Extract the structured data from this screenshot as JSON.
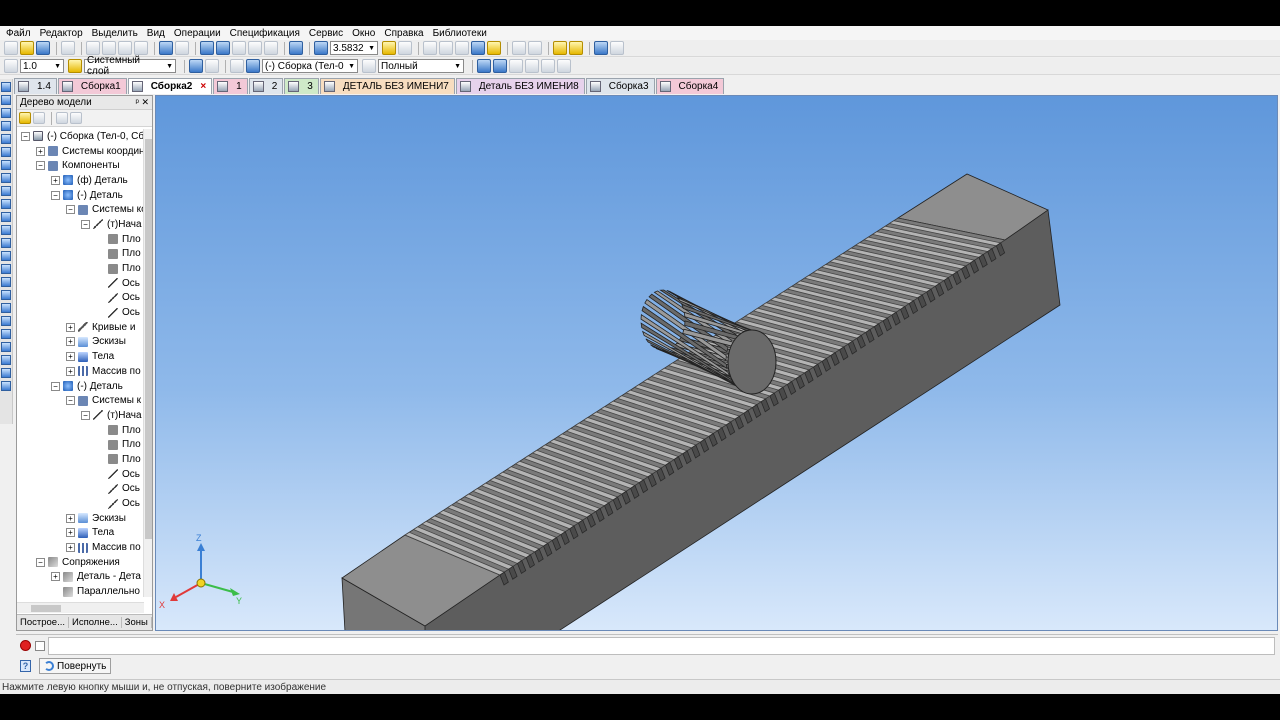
{
  "menu": [
    "Файл",
    "Редактор",
    "Выделить",
    "Вид",
    "Операции",
    "Спецификация",
    "Сервис",
    "Окно",
    "Справка",
    "Библиотеки"
  ],
  "toolbar": {
    "zoom_value": "3.5832",
    "line_weight": "1.0",
    "layer": "Системный слой",
    "object_filter": "(-) Сборка (Тел-0",
    "display_mode": "Полный"
  },
  "tabs": [
    {
      "label": "1.4",
      "style": "plain"
    },
    {
      "label": "Сборка1",
      "style": "pink"
    },
    {
      "label": "Сборка2",
      "style": "active"
    },
    {
      "label": "1",
      "style": "pink"
    },
    {
      "label": "2",
      "style": "plain"
    },
    {
      "label": "3",
      "style": "green"
    },
    {
      "label": "ДЕТАЛЬ БЕЗ ИМЕНИ7",
      "style": "orange"
    },
    {
      "label": "Деталь БЕЗ ИМЕНИ8",
      "style": "violet"
    },
    {
      "label": "Сборка3",
      "style": "plain"
    },
    {
      "label": "Сборка4",
      "style": "pink"
    }
  ],
  "tree": {
    "title": "Дерево модели",
    "nodes": [
      {
        "label": "(-) Сборка (Тел-0, Сб",
        "exp": "−",
        "indent": 0,
        "icon": "asm"
      },
      {
        "label": "Системы координ",
        "exp": "+",
        "indent": 1,
        "icon": "sys"
      },
      {
        "label": "Компоненты",
        "exp": "−",
        "indent": 1,
        "icon": "sys"
      },
      {
        "label": "(ф) Деталь",
        "exp": "+",
        "indent": 2,
        "icon": "part"
      },
      {
        "label": "(-) Деталь",
        "exp": "−",
        "indent": 2,
        "icon": "part"
      },
      {
        "label": "Системы ко",
        "exp": "−",
        "indent": 3,
        "icon": "sys"
      },
      {
        "label": "(т)Нача",
        "exp": "−",
        "indent": 4,
        "icon": "axis"
      },
      {
        "label": "Пло",
        "exp": "",
        "indent": 5,
        "icon": "plane"
      },
      {
        "label": "Пло",
        "exp": "",
        "indent": 5,
        "icon": "plane"
      },
      {
        "label": "Пло",
        "exp": "",
        "indent": 5,
        "icon": "plane"
      },
      {
        "label": "Ось",
        "exp": "",
        "indent": 5,
        "icon": "axis"
      },
      {
        "label": "Ось",
        "exp": "",
        "indent": 5,
        "icon": "axis"
      },
      {
        "label": "Ось",
        "exp": "",
        "indent": 5,
        "icon": "axis"
      },
      {
        "label": "Кривые и",
        "exp": "+",
        "indent": 3,
        "icon": "curve"
      },
      {
        "label": "Эскизы",
        "exp": "+",
        "indent": 3,
        "icon": "sketch"
      },
      {
        "label": "Тела",
        "exp": "+",
        "indent": 3,
        "icon": "body"
      },
      {
        "label": "Массив по",
        "exp": "+",
        "indent": 3,
        "icon": "array"
      },
      {
        "label": "(-) Деталь",
        "exp": "−",
        "indent": 2,
        "icon": "part"
      },
      {
        "label": "Системы к",
        "exp": "−",
        "indent": 3,
        "icon": "sys"
      },
      {
        "label": "(т)Нача",
        "exp": "−",
        "indent": 4,
        "icon": "axis"
      },
      {
        "label": "Пло",
        "exp": "",
        "indent": 5,
        "icon": "plane"
      },
      {
        "label": "Пло",
        "exp": "",
        "indent": 5,
        "icon": "plane"
      },
      {
        "label": "Пло",
        "exp": "",
        "indent": 5,
        "icon": "plane"
      },
      {
        "label": "Ось",
        "exp": "",
        "indent": 5,
        "icon": "axis"
      },
      {
        "label": "Ось",
        "exp": "",
        "indent": 5,
        "icon": "axis"
      },
      {
        "label": "Ось",
        "exp": "",
        "indent": 5,
        "icon": "axis"
      },
      {
        "label": "Эскизы",
        "exp": "+",
        "indent": 3,
        "icon": "sketch"
      },
      {
        "label": "Тела",
        "exp": "+",
        "indent": 3,
        "icon": "body"
      },
      {
        "label": "Массив по",
        "exp": "+",
        "indent": 3,
        "icon": "array"
      },
      {
        "label": "Сопряжения",
        "exp": "−",
        "indent": 1,
        "icon": "mate"
      },
      {
        "label": "Деталь - Дета",
        "exp": "+",
        "indent": 2,
        "icon": "mate"
      },
      {
        "label": "Параллельно",
        "exp": "",
        "indent": 2,
        "icon": "mate"
      }
    ],
    "bottom_tabs": [
      "Построе...",
      "Исполне...",
      "Зоны"
    ]
  },
  "axes": {
    "x": "X",
    "y": "Y",
    "z": "Z"
  },
  "command": {
    "rotate_label": "Повернуть"
  },
  "status": "Нажмите левую кнопку мыши и, не отпуская, поверните изображение",
  "colors": {
    "viewport_top": "#5f97db",
    "viewport_bottom": "#d8e8fb",
    "accent": "#3a7fd4"
  }
}
